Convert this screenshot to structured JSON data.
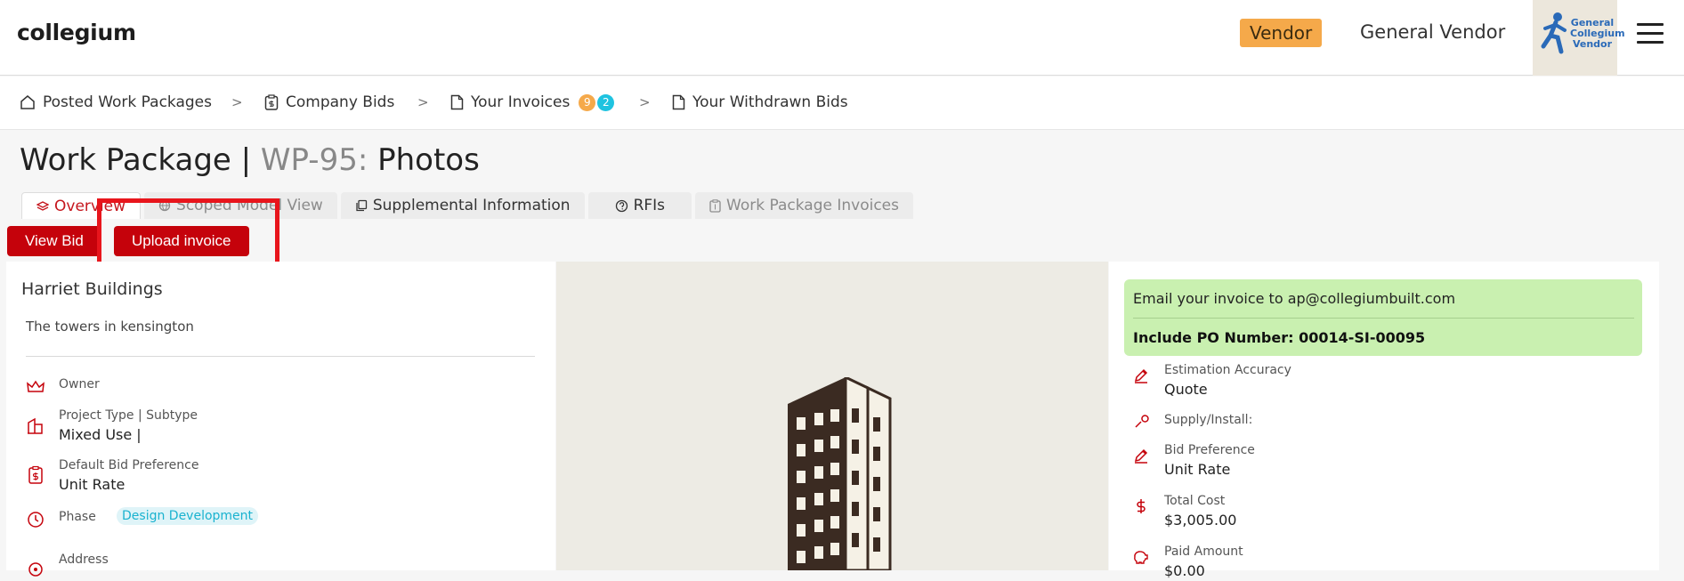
{
  "header": {
    "brand": "collegium",
    "role_badge": "Vendor",
    "vendor_name": "General Vendor",
    "avatar_text": [
      "General",
      "Collegium",
      "Vendor"
    ]
  },
  "nav": {
    "items": [
      {
        "label": "Posted Work Packages"
      },
      {
        "label": "Company Bids"
      },
      {
        "label": "Your Invoices",
        "badges": [
          "9",
          "2"
        ]
      },
      {
        "label": "Your Withdrawn Bids"
      }
    ],
    "separator": ">"
  },
  "page": {
    "title_prefix": "Work Package |",
    "wp_code": "WP-95:",
    "wp_name": "Photos"
  },
  "tabs": [
    {
      "label": "Overview",
      "active": true
    },
    {
      "label": "Scoped Model View"
    },
    {
      "label": "Supplemental Information"
    },
    {
      "label": "RFIs"
    },
    {
      "label": "Work Package Invoices"
    }
  ],
  "actions": {
    "view_bid": "View Bid",
    "upload_invoice": "Upload invoice"
  },
  "project": {
    "name": "Harriet Buildings",
    "description": "The towers in kensington",
    "fields": {
      "owner_label": "Owner",
      "type_label": "Project Type | Subtype",
      "type_value": "Mixed Use |",
      "bidpref_label": "Default Bid Preference",
      "bidpref_value": "Unit Rate",
      "phase_label": "Phase",
      "phase_value": "Design Development",
      "address_label": "Address"
    }
  },
  "invoice_info": {
    "email_line": "Email your invoice to ap@collegiumbuilt.com",
    "po_line": "Include PO Number: 00014-SI-00095",
    "fields": {
      "accuracy_label": "Estimation Accuracy",
      "accuracy_value": "Quote",
      "supply_label": "Supply/Install:",
      "bidpref_label": "Bid Preference",
      "bidpref_value": "Unit Rate",
      "total_label": "Total Cost",
      "total_value": "$3,005.00",
      "paid_label": "Paid Amount",
      "paid_value": "$0.00"
    }
  },
  "colors": {
    "accent": "#c5020b",
    "badge_orange": "#f5a94a",
    "badge_cyan": "#1fc3e0",
    "email_bg": "#c9f0b0"
  }
}
